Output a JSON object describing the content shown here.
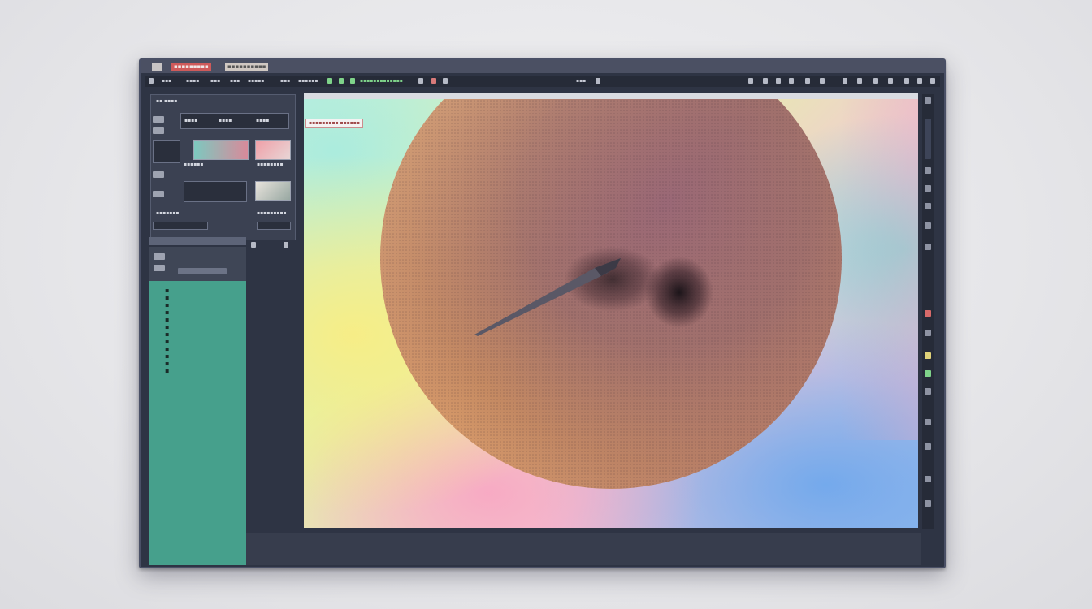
{
  "window": {
    "tabs": [
      "▪▪▪▪▪▪▪▪▪",
      "▪▪▪▪▪▪▪▪▪▪"
    ]
  },
  "menubar": {
    "items": [
      "▪▪▪",
      "▪▪▪▪",
      "▪▪▪",
      "▪▪▪",
      "▪▪▪▪▪",
      "▪▪▪",
      "▪▪▪▪▪▪"
    ],
    "status": "▪▪▪▪▪▪▪▪▪▪▪▪▪",
    "center": "▪▪▪"
  },
  "panel": {
    "header": "▪▪ ▪▪▪▪",
    "tabs": [
      "▪▪▪▪",
      "▪▪▪▪",
      "▪▪▪▪"
    ],
    "rows": [
      "▪▪▪▪▪▪",
      "▪▪▪▪▪▪▪▪",
      "▪▪▪▪▪▪▪",
      "▪▪▪▪▪▪▪▪▪"
    ],
    "side_label": "▪▪▪▪▪▪▪▪▪▪▪▪"
  },
  "canvas": {
    "tag": "▪▪▪▪▪▪▪▪▪ ▪▪▪▪▪▪"
  },
  "colors": {
    "accent_green": "#7fd38a",
    "teal_panel": "#46a08c",
    "chrome": "#2e3444"
  }
}
